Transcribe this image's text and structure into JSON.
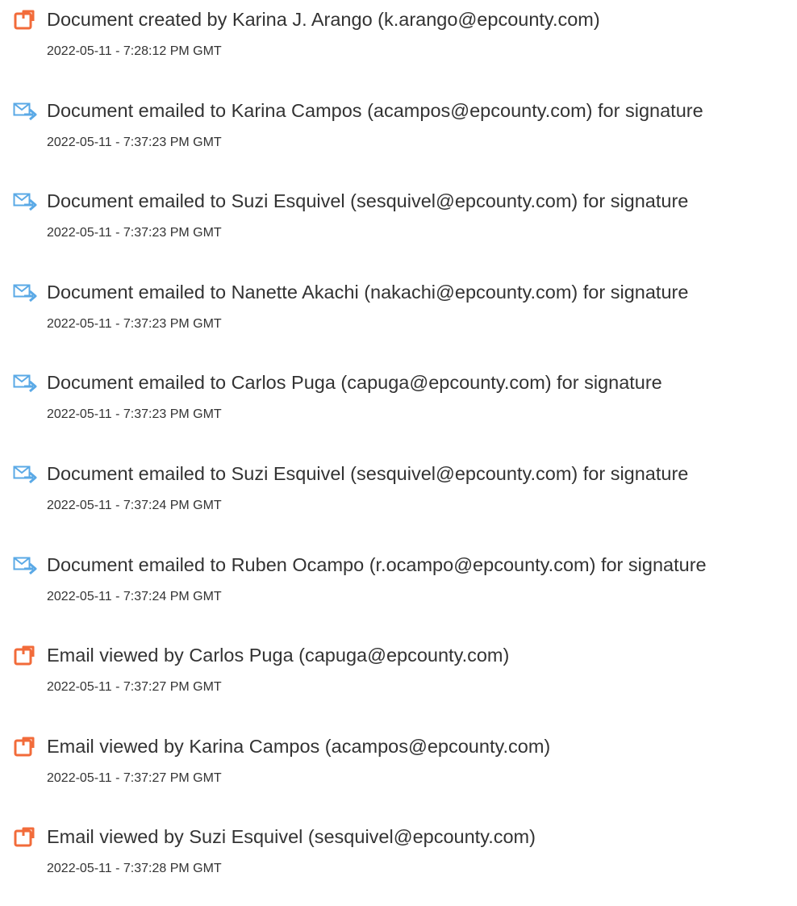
{
  "colors": {
    "doc_icon": "#f26b3a",
    "mail_icon": "#5aa9e6",
    "text": "#333333"
  },
  "events": [
    {
      "icon": "document-icon",
      "title": "Document created by Karina J. Arango (k.arango@epcounty.com)",
      "time": "2022-05-11 - 7:28:12 PM GMT"
    },
    {
      "icon": "email-sent-icon",
      "title": "Document emailed to Karina Campos (acampos@epcounty.com) for signature",
      "time": "2022-05-11 - 7:37:23 PM GMT"
    },
    {
      "icon": "email-sent-icon",
      "title": "Document emailed to Suzi Esquivel (sesquivel@epcounty.com) for signature",
      "time": "2022-05-11 - 7:37:23 PM GMT"
    },
    {
      "icon": "email-sent-icon",
      "title": "Document emailed to Nanette Akachi (nakachi@epcounty.com) for signature",
      "time": "2022-05-11 - 7:37:23 PM GMT"
    },
    {
      "icon": "email-sent-icon",
      "title": "Document emailed to Carlos Puga (capuga@epcounty.com) for signature",
      "time": "2022-05-11 - 7:37:23 PM GMT"
    },
    {
      "icon": "email-sent-icon",
      "title": "Document emailed to Suzi Esquivel (sesquivel@epcounty.com) for signature",
      "time": "2022-05-11 - 7:37:24 PM GMT"
    },
    {
      "icon": "email-sent-icon",
      "title": "Document emailed to Ruben Ocampo (r.ocampo@epcounty.com) for signature",
      "time": "2022-05-11 - 7:37:24 PM GMT"
    },
    {
      "icon": "document-icon",
      "title": "Email viewed by Carlos Puga (capuga@epcounty.com)",
      "time": "2022-05-11 - 7:37:27 PM GMT"
    },
    {
      "icon": "document-icon",
      "title": "Email viewed by Karina Campos (acampos@epcounty.com)",
      "time": "2022-05-11 - 7:37:27 PM GMT"
    },
    {
      "icon": "document-icon",
      "title": "Email viewed by Suzi Esquivel (sesquivel@epcounty.com)",
      "time": "2022-05-11 - 7:37:28 PM GMT"
    }
  ]
}
